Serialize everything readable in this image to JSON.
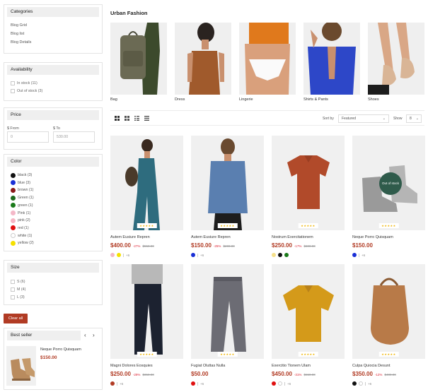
{
  "sidebar": {
    "categories": {
      "title": "Categories",
      "items": [
        "Blog Grid",
        "Blog list",
        "Blog Details"
      ]
    },
    "availability": {
      "title": "Availability",
      "items": [
        "In stock (11)",
        "Out of stock (3)"
      ]
    },
    "price": {
      "title": "Price",
      "from_label": "$ From",
      "to_label": "$ To",
      "from_placeholder": "0",
      "to_placeholder": "530.00"
    },
    "color": {
      "title": "Color",
      "items": [
        {
          "label": "black (3)",
          "color": "#111111"
        },
        {
          "label": "blue (3)",
          "color": "#1a2fd6"
        },
        {
          "label": "brown (1)",
          "color": "#8b1a1a"
        },
        {
          "label": "Green (1)",
          "color": "#1e6b1e"
        },
        {
          "label": "green (1)",
          "color": "#1a7a1a"
        },
        {
          "label": "Pink (1)",
          "color": "#f4b8c8"
        },
        {
          "label": "pink (2)",
          "color": "#f6b6c4"
        },
        {
          "label": "red (1)",
          "color": "#e01010"
        },
        {
          "label": "white (1)",
          "color": "#ffffff"
        },
        {
          "label": "yellow (2)",
          "color": "#f5e000"
        }
      ]
    },
    "size": {
      "title": "Size",
      "items": [
        "S (6)",
        "M (4)",
        "L (3)"
      ]
    },
    "clear_all": "Clear all",
    "best_seller": {
      "title": "Best seller",
      "prev_icon": "chevron-left-icon",
      "next_icon": "chevron-right-icon",
      "product": {
        "name": "Neque Porro Quisquam",
        "price": "$150.00"
      }
    }
  },
  "main": {
    "title": "Urban Fashion",
    "categories": [
      "Bag",
      "Dress",
      "Lingerie",
      "Shirts & Pants",
      "Shoes"
    ],
    "toolbar": {
      "sort_label": "Sort by",
      "sort_value": "Featured",
      "show_label": "Show",
      "show_value": "8",
      "view_icons": [
        "grid-2-icon",
        "grid-3-icon",
        "list-icon",
        "list-detail-icon"
      ]
    },
    "stars": "★★★★★",
    "products": [
      {
        "name": "Autem Eusiure Repren",
        "price": "$400.00",
        "pct": "-27%",
        "old": "$550.00",
        "swatches": [
          "#f4b8c8",
          "#f5e000"
        ],
        "more": "+6"
      },
      {
        "name": "Autem Eusiure Repren",
        "price": "$150.00",
        "pct": "-25%",
        "old": "$200.00",
        "swatches": [
          "#1a2fd6"
        ],
        "more": "+6"
      },
      {
        "name": "Nostrum Exercitationem",
        "price": "$250.00",
        "pct": "-17%",
        "old": "$300.00",
        "swatches": [
          "#f5e08a",
          "#111111",
          "#1a7a1a"
        ],
        "more": ""
      },
      {
        "name": "Neque Porro Quisquam",
        "price": "$150.00",
        "pct": "",
        "old": "",
        "swatches": [
          "#1a2fd6"
        ],
        "more": "+6",
        "badge": "Out of stock"
      },
      {
        "name": "Magni Dolores Eosquies",
        "price": "$250.00",
        "pct": "-29%",
        "old": "$350.00",
        "swatches": [
          "#b13b24"
        ],
        "more": "+6"
      },
      {
        "name": "Fugiat Oluttas Nulla",
        "price": "$50.00",
        "pct": "",
        "old": "",
        "swatches": [
          "#e01010"
        ],
        "more": "+6"
      },
      {
        "name": "Exercitio Tionem Ulam",
        "price": "$450.00",
        "pct": "-31%",
        "old": "$650.00",
        "swatches": [
          "#e01010",
          "#ffffff"
        ],
        "more": "+6"
      },
      {
        "name": "Culpa Quiocia Desunt",
        "price": "$350.00",
        "pct": "-12%",
        "old": "$400.00",
        "swatches": [
          "#111111",
          "#ffffff"
        ],
        "more": "+6"
      }
    ]
  }
}
